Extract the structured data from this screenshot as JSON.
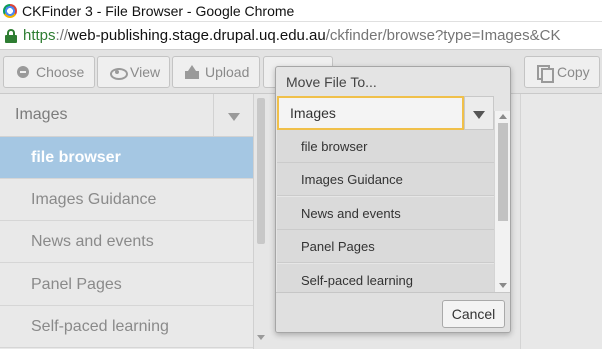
{
  "browser": {
    "window_title": "CKFinder 3 - File Browser - Google Chrome",
    "url_scheme": "https",
    "url_sep": "://",
    "url_host": "web-publishing.stage.drupal.uq.edu.au",
    "url_path": "/ckfinder/browse?type=Images&CK"
  },
  "toolbar": {
    "choose_label": "Choose",
    "view_label": "View",
    "upload_label": "Upload",
    "copy_label": "Copy"
  },
  "sidebar": {
    "root_label": "Images",
    "items": [
      {
        "label": "file browser",
        "active": true
      },
      {
        "label": "Images Guidance",
        "active": false
      },
      {
        "label": "News and events",
        "active": false
      },
      {
        "label": "Panel Pages",
        "active": false
      },
      {
        "label": "Self-paced learning",
        "active": false
      }
    ]
  },
  "dialog": {
    "title": "Move File To...",
    "selected_folder": "Images",
    "folders": [
      "file browser",
      "Images Guidance",
      "News and events",
      "Panel Pages",
      "Self-paced learning"
    ],
    "cancel_label": "Cancel"
  },
  "colors": {
    "active_folder_bg": "#a5c7e3",
    "select_focus_border": "#f0c04a",
    "secure_green": "#2e7d32"
  }
}
